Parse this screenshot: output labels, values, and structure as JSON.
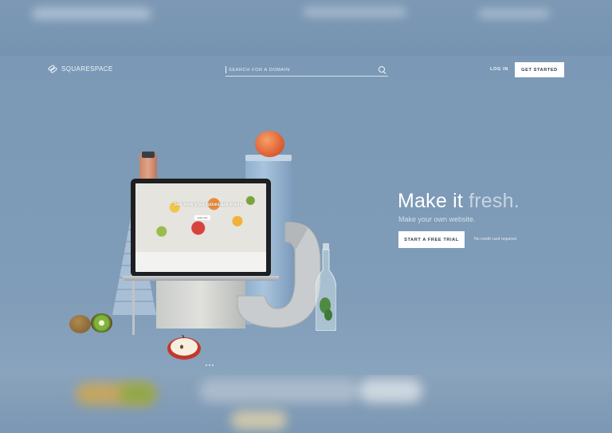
{
  "header": {
    "logo_text": "SQUARESPACE",
    "search_placeholder": "SEARCH FOR A DOMAIN",
    "login_label": "LOG IN",
    "get_started_label": "GET STARTED"
  },
  "hero": {
    "headline_primary": "Make it",
    "headline_accent": "fresh.",
    "subhead": "Make your own website.",
    "cta_label": "START A FREE TRIAL",
    "cta_note": "No credit card required."
  },
  "laptop_screen": {
    "headline": "See how your juices are made",
    "button_label": "Learn more"
  },
  "icons": {
    "logo": "squarespace-logo-icon",
    "search": "search-icon"
  },
  "colors": {
    "background": "#7f9bb6",
    "button_bg": "#ffffff",
    "button_text": "#2c3a48",
    "headline_accent": "#c7d5e2"
  }
}
